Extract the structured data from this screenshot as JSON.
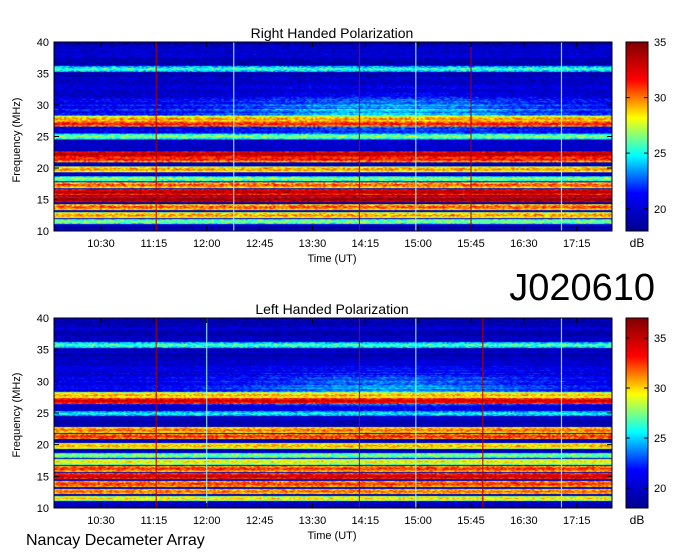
{
  "figure_code": "J020610",
  "footer": "Nancay Decameter Array",
  "colorbar_unit": "dB",
  "colors": {
    "colormap": [
      "#00008f",
      "#0000ff",
      "#00ffff",
      "#ffff00",
      "#ff0000",
      "#800000"
    ]
  },
  "chart_data": [
    {
      "type": "heatmap",
      "title": "Right Handed Polarization",
      "xlabel": "Time (UT)",
      "ylabel": "Frequency (MHz)",
      "x_ticks": [
        "10:30",
        "11:15",
        "12:00",
        "12:45",
        "13:30",
        "14:15",
        "15:00",
        "15:45",
        "16:30",
        "17:15"
      ],
      "x_tick_minutes": [
        630,
        675,
        720,
        765,
        810,
        855,
        900,
        945,
        990,
        1035
      ],
      "xlim_minutes": [
        590,
        1065
      ],
      "y_ticks": [
        10,
        15,
        20,
        25,
        30,
        35,
        40
      ],
      "ylim": [
        10,
        40
      ],
      "colorbar_ticks": [
        20,
        25,
        30,
        35
      ],
      "clim": [
        18,
        35
      ],
      "bands": [
        {
          "f": 11.5,
          "level": 27
        },
        {
          "f": 12.5,
          "level": 30
        },
        {
          "f": 13.8,
          "level": 31
        },
        {
          "f": 15.0,
          "level": 35
        },
        {
          "f": 16.2,
          "level": 34
        },
        {
          "f": 17.3,
          "level": 31
        },
        {
          "f": 18.3,
          "level": 27
        },
        {
          "f": 19.8,
          "level": 30
        },
        {
          "f": 21.4,
          "level": 32
        },
        {
          "f": 22.2,
          "level": 34
        },
        {
          "f": 25.0,
          "level": 27
        },
        {
          "f": 27.0,
          "level": 32
        },
        {
          "f": 27.8,
          "level": 30
        },
        {
          "f": 35.7,
          "level": 26
        }
      ],
      "vertical_lines_minutes": [
        677,
        743,
        850,
        898,
        945,
        1022
      ]
    },
    {
      "type": "heatmap",
      "title": "Left Handed Polarization",
      "xlabel": "Time (UT)",
      "ylabel": "Frequency (MHz)",
      "x_ticks": [
        "10:30",
        "11:15",
        "12:00",
        "12:45",
        "13:30",
        "14:15",
        "15:00",
        "15:45",
        "16:30",
        "17:15"
      ],
      "x_tick_minutes": [
        630,
        675,
        720,
        765,
        810,
        855,
        900,
        945,
        990,
        1035
      ],
      "xlim_minutes": [
        590,
        1065
      ],
      "y_ticks": [
        10,
        15,
        20,
        25,
        30,
        35,
        40
      ],
      "ylim": [
        10,
        40
      ],
      "colorbar_ticks": [
        20,
        25,
        30,
        35
      ],
      "clim": [
        18,
        37
      ],
      "bands": [
        {
          "f": 11.5,
          "level": 30
        },
        {
          "f": 12.6,
          "level": 32
        },
        {
          "f": 13.8,
          "level": 33
        },
        {
          "f": 15.0,
          "level": 35
        },
        {
          "f": 16.2,
          "level": 33
        },
        {
          "f": 17.3,
          "level": 30
        },
        {
          "f": 18.3,
          "level": 28
        },
        {
          "f": 19.8,
          "level": 31
        },
        {
          "f": 21.3,
          "level": 33
        },
        {
          "f": 22.3,
          "level": 32
        },
        {
          "f": 24.9,
          "level": 26
        },
        {
          "f": 26.9,
          "level": 35
        },
        {
          "f": 27.8,
          "level": 31
        },
        {
          "f": 35.7,
          "level": 27
        }
      ],
      "vertical_lines_minutes": [
        677,
        720,
        850,
        898,
        955,
        1022
      ]
    }
  ]
}
